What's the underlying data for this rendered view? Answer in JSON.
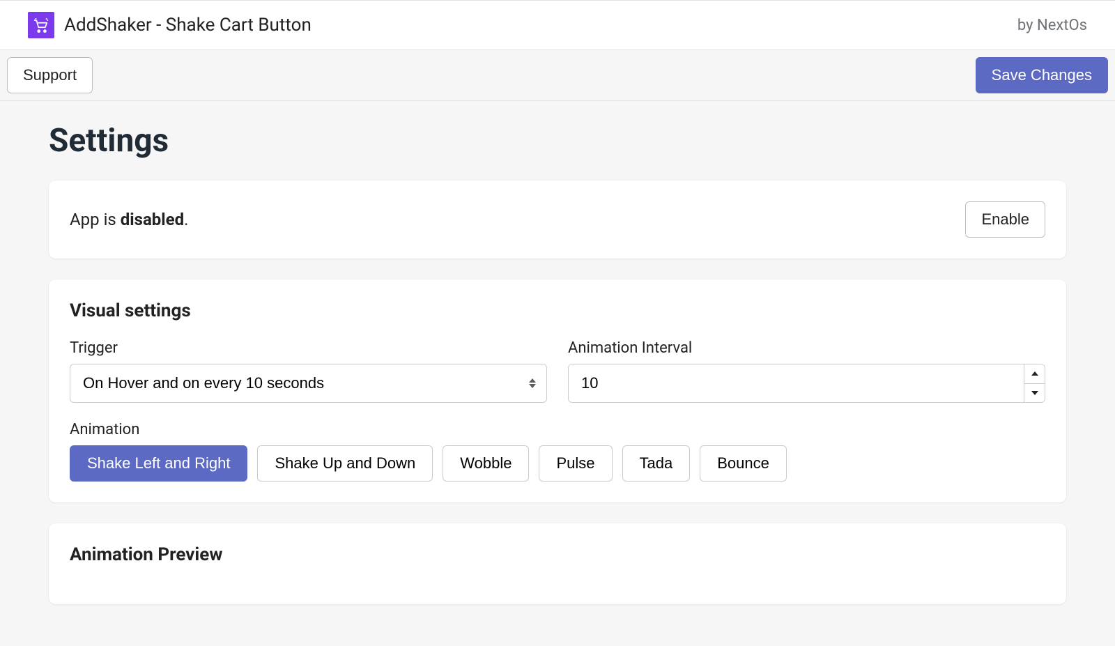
{
  "header": {
    "app_title": "AddShaker - Shake Cart Button",
    "by": "by NextOs"
  },
  "actionbar": {
    "support": "Support",
    "save": "Save Changes"
  },
  "page": {
    "title": "Settings"
  },
  "status": {
    "prefix": "App is ",
    "state": "disabled",
    "suffix": ".",
    "enable_label": "Enable"
  },
  "visual": {
    "section_title": "Visual settings",
    "trigger_label": "Trigger",
    "trigger_value": "On Hover and on every 10 seconds",
    "interval_label": "Animation Interval",
    "interval_value": "10",
    "animation_label": "Animation",
    "animations": [
      {
        "label": "Shake Left and Right",
        "active": true
      },
      {
        "label": "Shake Up and Down",
        "active": false
      },
      {
        "label": "Wobble",
        "active": false
      },
      {
        "label": "Pulse",
        "active": false
      },
      {
        "label": "Tada",
        "active": false
      },
      {
        "label": "Bounce",
        "active": false
      }
    ]
  },
  "preview": {
    "section_title": "Animation Preview"
  }
}
